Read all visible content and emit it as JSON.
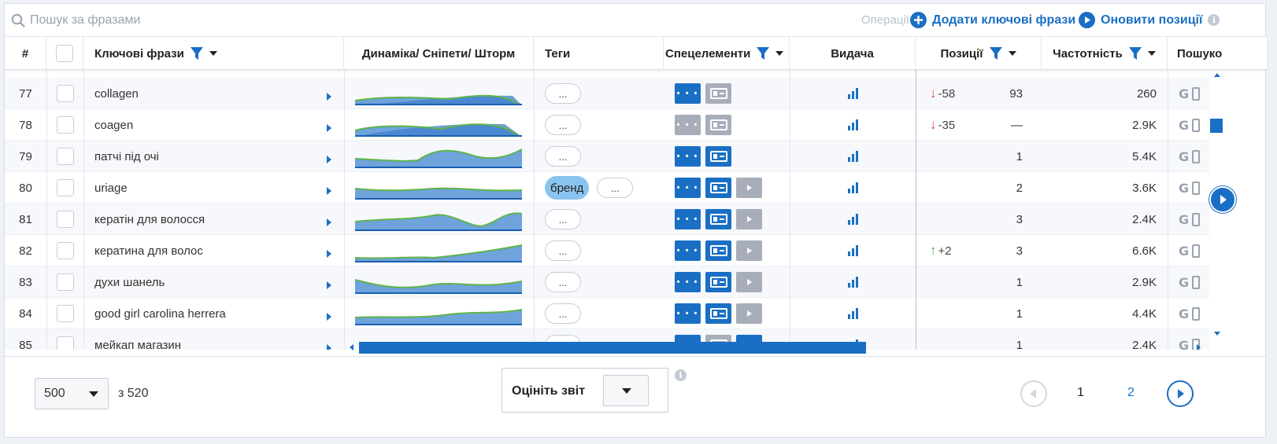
{
  "search": {
    "placeholder": "Пошук за фразами"
  },
  "toolbar": {
    "operations_label": "Операції",
    "add_keywords_label": "Додати ключові фрази",
    "update_positions_label": "Оновити позиції"
  },
  "table": {
    "headers": {
      "num": "#",
      "keywords": "Ключові фрази",
      "dynamics": "Динаміка/ Сніпети/ Шторм",
      "tags": "Теги",
      "special": "Спецелементи",
      "serp": "Видача",
      "positions": "Позиції",
      "frequency": "Частотність",
      "search": "Пошуко"
    },
    "rows": [
      {
        "num": "77",
        "keyword": "collagen",
        "tag": "",
        "tag_more": "...",
        "special": [
          "blue-dots",
          "grey-snippet"
        ],
        "change_dir": "down",
        "change": "-58",
        "position": "93",
        "frequency": "260",
        "dots": "• • •"
      },
      {
        "num": "78",
        "keyword": "coagen",
        "tag": "",
        "tag_more": "...",
        "special": [
          "grey-dots",
          "grey-snippet"
        ],
        "change_dir": "down",
        "change": "-35",
        "position": "—",
        "frequency": "2.9K",
        "dots": "• • •"
      },
      {
        "num": "79",
        "keyword": "патчі під очі",
        "tag": "",
        "tag_more": "...",
        "special": [
          "blue-dots",
          "blue-snippet"
        ],
        "change_dir": "",
        "change": "",
        "position": "1",
        "frequency": "5.4K",
        "dots": "• • •"
      },
      {
        "num": "80",
        "keyword": "uriage",
        "tag": "бренд",
        "tag_more": "...",
        "special": [
          "blue-dots",
          "blue-snippet",
          "grey-video"
        ],
        "change_dir": "",
        "change": "",
        "position": "2",
        "frequency": "3.6K",
        "dots": "• • •"
      },
      {
        "num": "81",
        "keyword": "кератін для волосся",
        "tag": "",
        "tag_more": "...",
        "special": [
          "blue-dots",
          "blue-snippet",
          "grey-video"
        ],
        "change_dir": "",
        "change": "",
        "position": "3",
        "frequency": "2.4K",
        "dots": "• • •"
      },
      {
        "num": "82",
        "keyword": "кератина для волос",
        "tag": "",
        "tag_more": "...",
        "special": [
          "blue-dots",
          "blue-snippet",
          "grey-video"
        ],
        "change_dir": "up",
        "change": "+2",
        "position": "3",
        "frequency": "6.6K",
        "dots": "• • •"
      },
      {
        "num": "83",
        "keyword": "духи шанель",
        "tag": "",
        "tag_more": "...",
        "special": [
          "blue-dots",
          "blue-snippet",
          "grey-video"
        ],
        "change_dir": "",
        "change": "",
        "position": "1",
        "frequency": "2.9K",
        "dots": "• • •"
      },
      {
        "num": "84",
        "keyword": "good girl carolina herrera",
        "tag": "",
        "tag_more": "...",
        "special": [
          "blue-dots",
          "blue-snippet",
          "grey-video"
        ],
        "change_dir": "",
        "change": "",
        "position": "1",
        "frequency": "4.4K",
        "dots": "• • •"
      },
      {
        "num": "85",
        "keyword": "мейкап магазин",
        "tag": "",
        "tag_more": "...",
        "special": [
          "blue-dots",
          "grey-snippet",
          "blue-video"
        ],
        "change_dir": "",
        "change": "",
        "position": "1",
        "frequency": "2.4K",
        "dots": "• • •"
      }
    ]
  },
  "footer": {
    "per_page": "500",
    "of_total": "з 520",
    "rate_label": "Оцініть звіт",
    "pages": [
      "1",
      "2"
    ],
    "current_page": "1"
  },
  "colors": {
    "accent": "#1a6fc4",
    "down": "#e04646",
    "up": "#47b14a",
    "grey": "#a7adb9"
  },
  "icons": {
    "search": "search-icon",
    "add": "plus-circle-icon",
    "update": "play-circle-icon",
    "filter": "filter-icon",
    "info": "info-icon",
    "google": "google-icon",
    "mobile": "mobile-icon"
  }
}
